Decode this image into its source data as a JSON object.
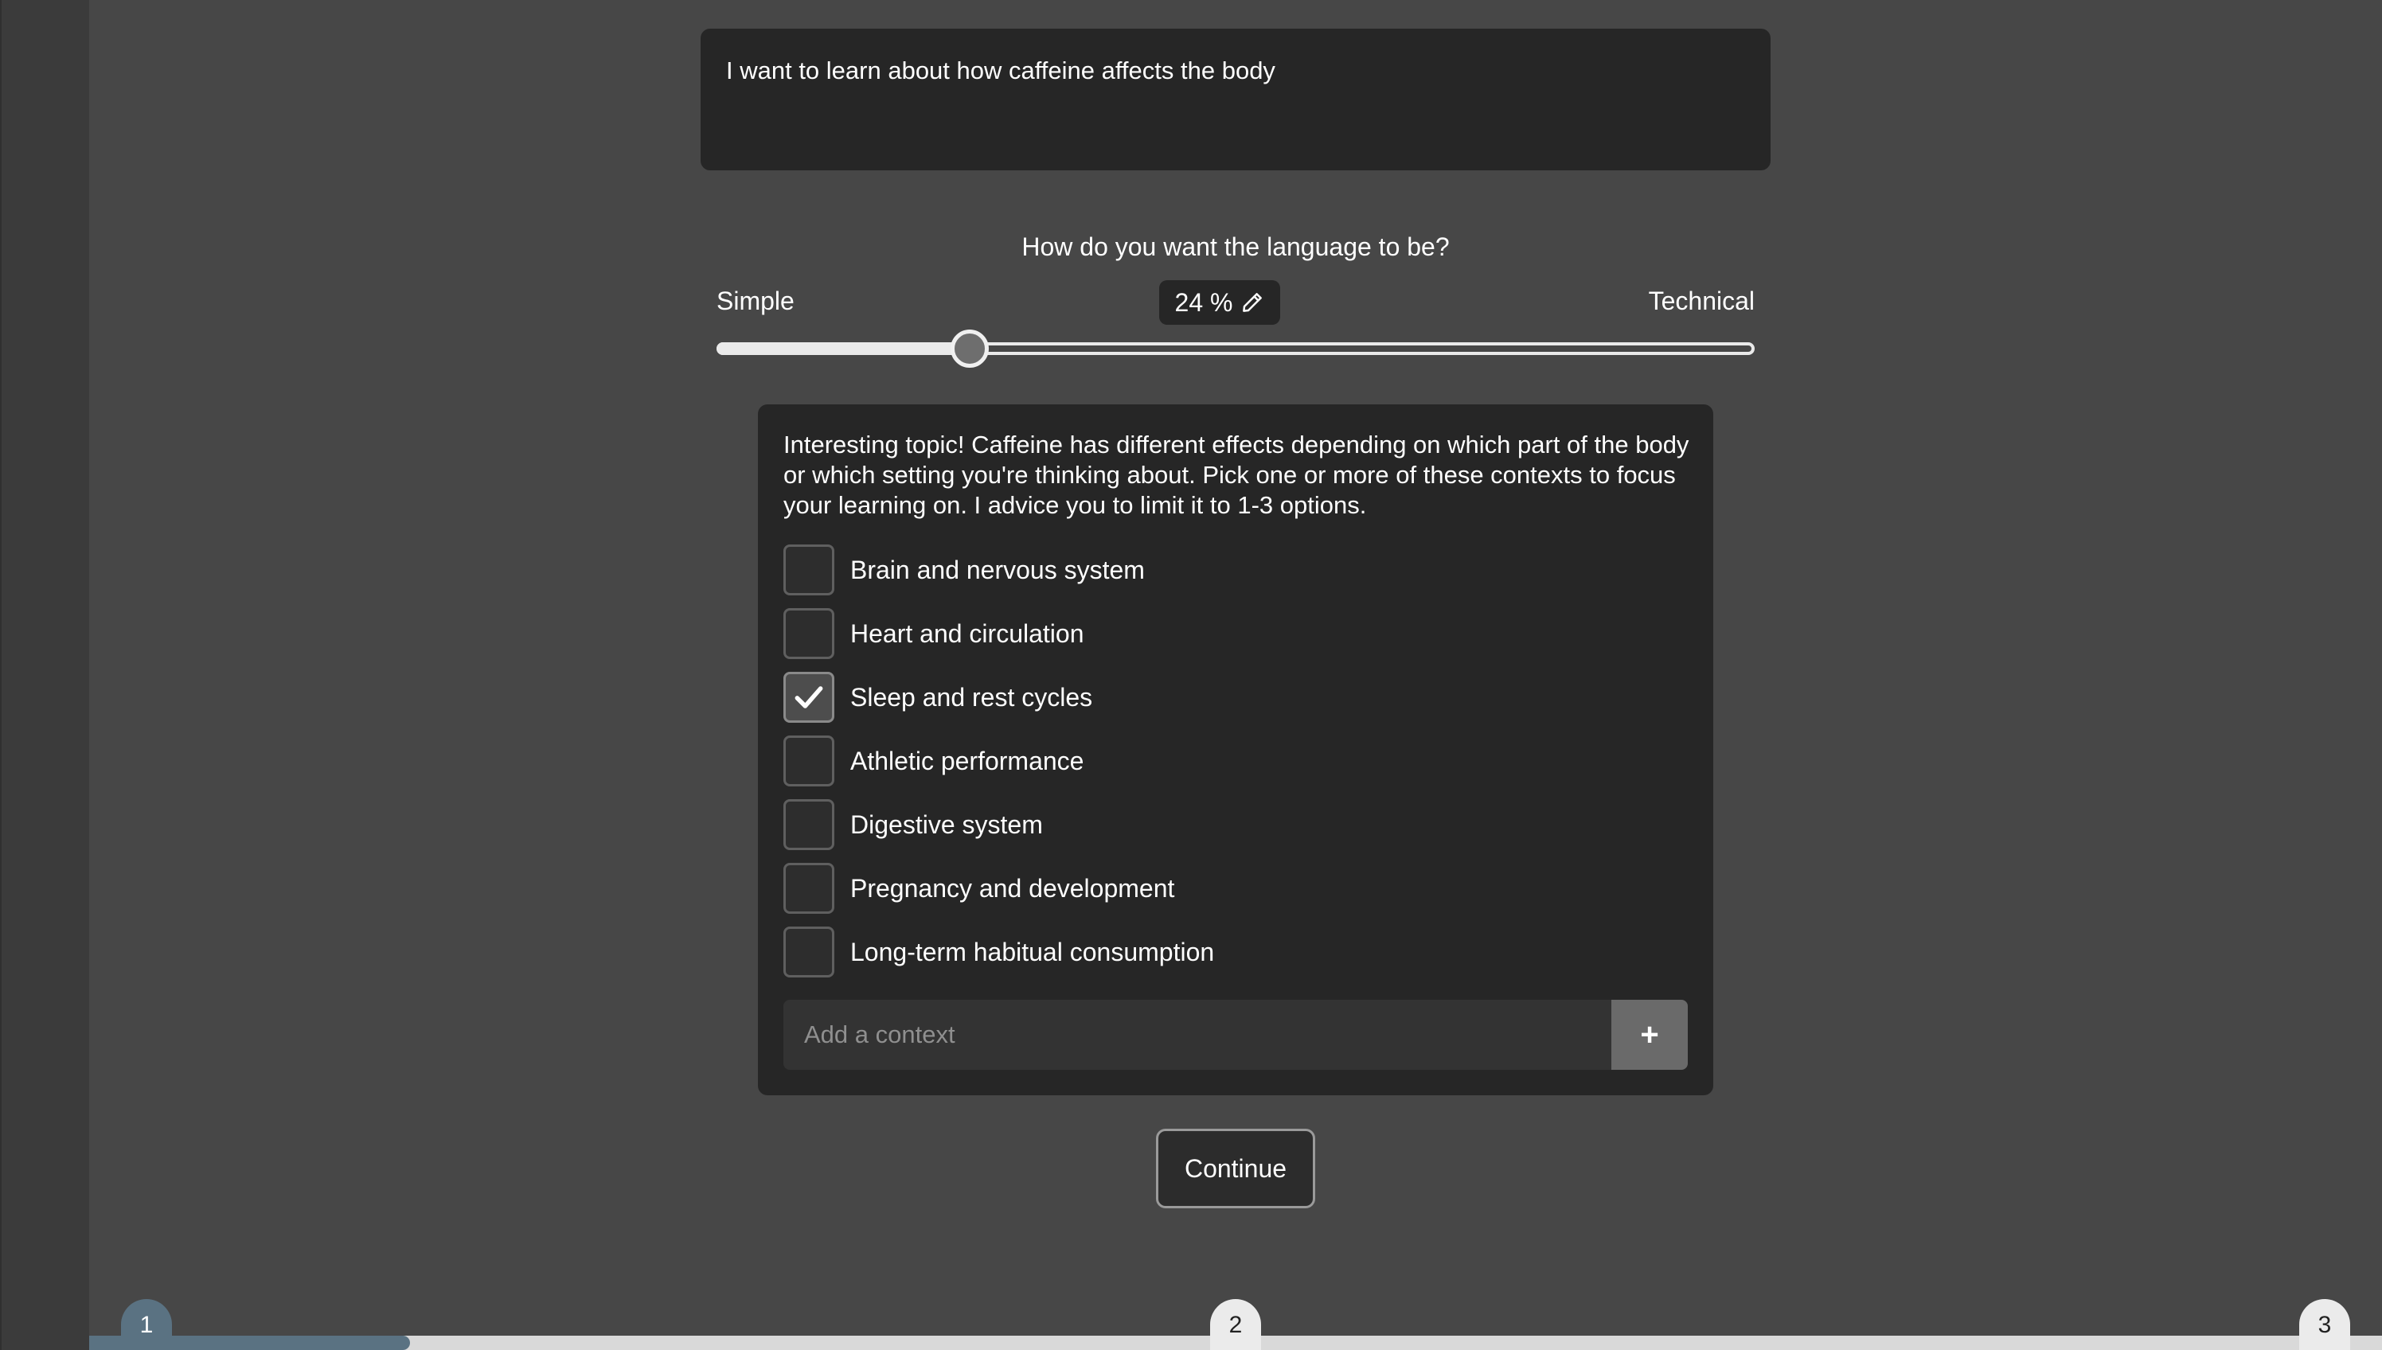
{
  "prompt": {
    "text": "I want to learn about how caffeine affects the body"
  },
  "language": {
    "question": "How do you want the language to be?",
    "min_label": "Simple",
    "max_label": "Technical",
    "value": 24,
    "value_text": "24 %"
  },
  "context": {
    "intro": "Interesting topic! Caffeine has different effects depending on which part of the body or which setting you're thinking about. Pick one or more of these contexts to focus your learning on. I advice you to limit it to 1-3 options.",
    "options": [
      {
        "label": "Brain and nervous system",
        "checked": false
      },
      {
        "label": "Heart and circulation",
        "checked": false
      },
      {
        "label": "Sleep and rest cycles",
        "checked": true
      },
      {
        "label": "Athletic performance",
        "checked": false
      },
      {
        "label": "Digestive system",
        "checked": false
      },
      {
        "label": "Pregnancy and development",
        "checked": false
      },
      {
        "label": "Long-term habitual consumption",
        "checked": false
      }
    ],
    "add_placeholder": "Add a context",
    "add_button": "+"
  },
  "actions": {
    "continue_label": "Continue"
  },
  "progress": {
    "fraction": 0.14,
    "steps": [
      "1",
      "2",
      "3"
    ],
    "current_step": 1
  },
  "colors": {
    "background": "#474747",
    "panel": "#262626",
    "progress_accent": "#5a7282",
    "progress_track": "#d9d9d9"
  }
}
